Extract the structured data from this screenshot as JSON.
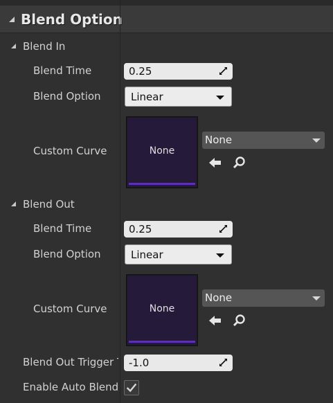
{
  "section": {
    "title": "Blend Option"
  },
  "blend_in": {
    "header": "Blend In",
    "blend_time_label": "Blend Time",
    "blend_time_value": "0.25",
    "blend_option_label": "Blend Option",
    "blend_option_value": "Linear",
    "custom_curve_label": "Custom Curve",
    "curve_thumb_text": "None",
    "curve_asset_value": "None"
  },
  "blend_out": {
    "header": "Blend Out",
    "blend_time_label": "Blend Time",
    "blend_time_value": "0.25",
    "blend_option_label": "Blend Option",
    "blend_option_value": "Linear",
    "custom_curve_label": "Custom Curve",
    "curve_thumb_text": "None",
    "curve_asset_value": "None"
  },
  "trigger": {
    "label": "Blend Out Trigger T",
    "value": "-1.0"
  },
  "auto_blend": {
    "label": "Enable Auto Blend C",
    "checked": true
  },
  "colors": {
    "panel_bg": "#303030",
    "header_bg": "#3a3a3a",
    "thumb_bg": "#261a3a",
    "accent_purple": "#5a32b0"
  },
  "icons": [
    "collapse-arrow-icon",
    "drag-handle-icon",
    "dropdown-caret-icon",
    "use-selected-arrow-icon",
    "browse-magnifier-icon",
    "checkmark-icon"
  ]
}
